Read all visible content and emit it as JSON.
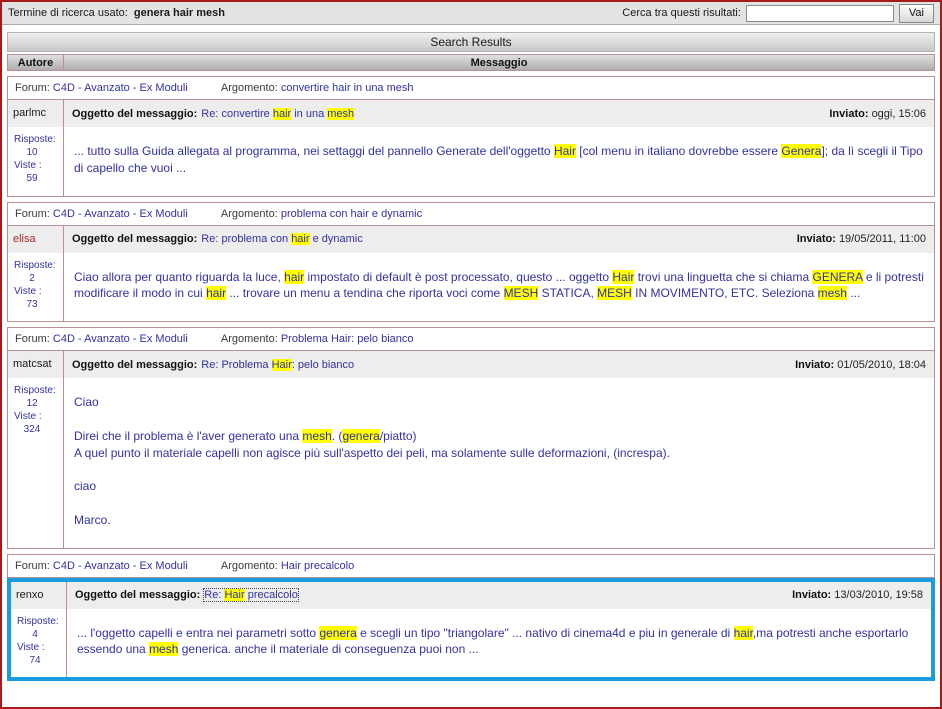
{
  "top_bar": {
    "term_label": "Termine di ricerca usato:",
    "term_value": "genera hair mesh",
    "refine_label": "Cerca tra questi risultati:",
    "refine_value": "",
    "go_button": "Vai"
  },
  "results_header": {
    "title": "Search Results",
    "col_author": "Autore",
    "col_message": "Messaggio"
  },
  "labels": {
    "forum": "Forum:",
    "topic": "Argomento:",
    "subject": "Oggetto del messaggio:",
    "sent": "Inviato:",
    "replies": "Risposte:",
    "views": "Viste :"
  },
  "colors": {
    "page_border": "#A61A1A",
    "table_border": "#BA8F8F",
    "highlight": "#FFFF00",
    "body_text": "#32329E",
    "selection": "#1B9BE0",
    "moderator_red": "#A52A2A"
  },
  "results": [
    {
      "forum": "C4D - Avanzato - Ex Moduli",
      "topic": "convertire hair in una mesh",
      "author": "parlmc",
      "author_color": "#1A1A1A",
      "subject": [
        {
          "t": "Re: convertire "
        },
        {
          "t": "hair",
          "h": true
        },
        {
          "t": " in una "
        },
        {
          "t": "mesh",
          "h": true
        }
      ],
      "sent": "oggi, 15:06",
      "replies": "10",
      "views": "59",
      "body": [
        {
          "t": "... tutto sulla Guida allegata al programma, nei settaggi del pannello Generate dell'oggetto "
        },
        {
          "t": "Hair",
          "h": true
        },
        {
          "t": " [col menu in italiano dovrebbe essere "
        },
        {
          "t": "Genera",
          "h": true
        },
        {
          "t": "]; da lì scegli il Tipo di capello che vuoi ..."
        }
      ],
      "selected": false,
      "subject_focused": false
    },
    {
      "forum": "C4D - Avanzato - Ex Moduli",
      "topic": "problema con hair e dynamic",
      "author": "elisa",
      "author_color": "#A52A2A",
      "subject": [
        {
          "t": "Re: problema con "
        },
        {
          "t": "hair",
          "h": true
        },
        {
          "t": " e dynamic"
        }
      ],
      "sent": "19/05/2011, 11:00",
      "replies": "2",
      "views": "73",
      "body": [
        {
          "t": "Ciao allora per quanto riguarda la luce, "
        },
        {
          "t": "hair",
          "h": true
        },
        {
          "t": " impostato di default è post processato, questo ... oggetto "
        },
        {
          "t": "Hair",
          "h": true
        },
        {
          "t": " trovi una linguetta che si chiama "
        },
        {
          "t": "GENERA",
          "h": true
        },
        {
          "t": " e li potresti modificare il modo in cui "
        },
        {
          "t": "hair",
          "h": true
        },
        {
          "t": " ... trovare un menu a tendina che riporta voci come "
        },
        {
          "t": "MESH",
          "h": true
        },
        {
          "t": " STATICA, "
        },
        {
          "t": "MESH",
          "h": true
        },
        {
          "t": " IN MOVIMENTO, ETC. Seleziona "
        },
        {
          "t": "mesh",
          "h": true
        },
        {
          "t": " ..."
        }
      ],
      "selected": false,
      "subject_focused": false
    },
    {
      "forum": "C4D - Avanzato - Ex Moduli",
      "topic": "Problema Hair: pelo bianco",
      "author": "matcsat",
      "author_color": "#1A1A1A",
      "subject": [
        {
          "t": "Re: Problema "
        },
        {
          "t": "Hair",
          "h": true
        },
        {
          "t": ": pelo bianco"
        }
      ],
      "sent": "01/05/2010, 18:04",
      "replies": "12",
      "views": "324",
      "body": [
        {
          "t": "Ciao\n\nDirei che il problema è l'aver generato una "
        },
        {
          "t": "mesh",
          "h": true
        },
        {
          "t": ". ("
        },
        {
          "t": "genera",
          "h": true
        },
        {
          "t": "/piatto)\nA quel punto il materiale capelli non agisce più sull'aspetto dei peli, ma solamente sulle deformazioni, (increspa).\n\nciao\n\nMarco."
        }
      ],
      "selected": false,
      "subject_focused": false
    },
    {
      "forum": "C4D - Avanzato - Ex Moduli",
      "topic": "Hair precalcolo",
      "author": "renxo",
      "author_color": "#1A1A1A",
      "subject": [
        {
          "t": "Re: "
        },
        {
          "t": "Hair",
          "h": true
        },
        {
          "t": " precalcolo"
        }
      ],
      "sent": "13/03/2010, 19:58",
      "replies": "4",
      "views": "74",
      "body": [
        {
          "t": "... l'oggetto capelli e entra nei parametri sotto "
        },
        {
          "t": "genera",
          "h": true
        },
        {
          "t": " e scegli un tipo \"triangolare\" ... nativo di cinema4d e piu in generale di "
        },
        {
          "t": "hair",
          "h": true
        },
        {
          "t": ",ma potresti anche esportarlo essendo una "
        },
        {
          "t": "mesh",
          "h": true
        },
        {
          "t": " generica. anche il materiale di conseguenza puoi non ..."
        }
      ],
      "selected": true,
      "subject_focused": true
    }
  ]
}
